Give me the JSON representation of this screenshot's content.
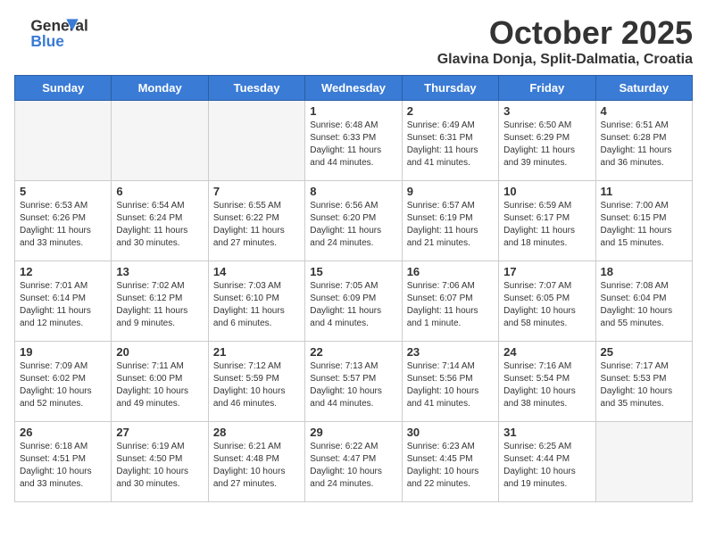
{
  "header": {
    "logo_general": "General",
    "logo_blue": "Blue",
    "month_title": "October 2025",
    "location": "Glavina Donja, Split-Dalmatia, Croatia"
  },
  "days_of_week": [
    "Sunday",
    "Monday",
    "Tuesday",
    "Wednesday",
    "Thursday",
    "Friday",
    "Saturday"
  ],
  "weeks": [
    [
      {
        "day": "",
        "empty": true
      },
      {
        "day": "",
        "empty": true
      },
      {
        "day": "",
        "empty": true
      },
      {
        "day": "1",
        "sunrise": "6:48 AM",
        "sunset": "6:33 PM",
        "daylight": "11 hours and 44 minutes."
      },
      {
        "day": "2",
        "sunrise": "6:49 AM",
        "sunset": "6:31 PM",
        "daylight": "11 hours and 41 minutes."
      },
      {
        "day": "3",
        "sunrise": "6:50 AM",
        "sunset": "6:29 PM",
        "daylight": "11 hours and 39 minutes."
      },
      {
        "day": "4",
        "sunrise": "6:51 AM",
        "sunset": "6:28 PM",
        "daylight": "11 hours and 36 minutes."
      }
    ],
    [
      {
        "day": "5",
        "sunrise": "6:53 AM",
        "sunset": "6:26 PM",
        "daylight": "11 hours and 33 minutes."
      },
      {
        "day": "6",
        "sunrise": "6:54 AM",
        "sunset": "6:24 PM",
        "daylight": "11 hours and 30 minutes."
      },
      {
        "day": "7",
        "sunrise": "6:55 AM",
        "sunset": "6:22 PM",
        "daylight": "11 hours and 27 minutes."
      },
      {
        "day": "8",
        "sunrise": "6:56 AM",
        "sunset": "6:20 PM",
        "daylight": "11 hours and 24 minutes."
      },
      {
        "day": "9",
        "sunrise": "6:57 AM",
        "sunset": "6:19 PM",
        "daylight": "11 hours and 21 minutes."
      },
      {
        "day": "10",
        "sunrise": "6:59 AM",
        "sunset": "6:17 PM",
        "daylight": "11 hours and 18 minutes."
      },
      {
        "day": "11",
        "sunrise": "7:00 AM",
        "sunset": "6:15 PM",
        "daylight": "11 hours and 15 minutes."
      }
    ],
    [
      {
        "day": "12",
        "sunrise": "7:01 AM",
        "sunset": "6:14 PM",
        "daylight": "11 hours and 12 minutes."
      },
      {
        "day": "13",
        "sunrise": "7:02 AM",
        "sunset": "6:12 PM",
        "daylight": "11 hours and 9 minutes."
      },
      {
        "day": "14",
        "sunrise": "7:03 AM",
        "sunset": "6:10 PM",
        "daylight": "11 hours and 6 minutes."
      },
      {
        "day": "15",
        "sunrise": "7:05 AM",
        "sunset": "6:09 PM",
        "daylight": "11 hours and 4 minutes."
      },
      {
        "day": "16",
        "sunrise": "7:06 AM",
        "sunset": "6:07 PM",
        "daylight": "11 hours and 1 minute."
      },
      {
        "day": "17",
        "sunrise": "7:07 AM",
        "sunset": "6:05 PM",
        "daylight": "10 hours and 58 minutes."
      },
      {
        "day": "18",
        "sunrise": "7:08 AM",
        "sunset": "6:04 PM",
        "daylight": "10 hours and 55 minutes."
      }
    ],
    [
      {
        "day": "19",
        "sunrise": "7:09 AM",
        "sunset": "6:02 PM",
        "daylight": "10 hours and 52 minutes."
      },
      {
        "day": "20",
        "sunrise": "7:11 AM",
        "sunset": "6:00 PM",
        "daylight": "10 hours and 49 minutes."
      },
      {
        "day": "21",
        "sunrise": "7:12 AM",
        "sunset": "5:59 PM",
        "daylight": "10 hours and 46 minutes."
      },
      {
        "day": "22",
        "sunrise": "7:13 AM",
        "sunset": "5:57 PM",
        "daylight": "10 hours and 44 minutes."
      },
      {
        "day": "23",
        "sunrise": "7:14 AM",
        "sunset": "5:56 PM",
        "daylight": "10 hours and 41 minutes."
      },
      {
        "day": "24",
        "sunrise": "7:16 AM",
        "sunset": "5:54 PM",
        "daylight": "10 hours and 38 minutes."
      },
      {
        "day": "25",
        "sunrise": "7:17 AM",
        "sunset": "5:53 PM",
        "daylight": "10 hours and 35 minutes."
      }
    ],
    [
      {
        "day": "26",
        "sunrise": "6:18 AM",
        "sunset": "4:51 PM",
        "daylight": "10 hours and 33 minutes."
      },
      {
        "day": "27",
        "sunrise": "6:19 AM",
        "sunset": "4:50 PM",
        "daylight": "10 hours and 30 minutes."
      },
      {
        "day": "28",
        "sunrise": "6:21 AM",
        "sunset": "4:48 PM",
        "daylight": "10 hours and 27 minutes."
      },
      {
        "day": "29",
        "sunrise": "6:22 AM",
        "sunset": "4:47 PM",
        "daylight": "10 hours and 24 minutes."
      },
      {
        "day": "30",
        "sunrise": "6:23 AM",
        "sunset": "4:45 PM",
        "daylight": "10 hours and 22 minutes."
      },
      {
        "day": "31",
        "sunrise": "6:25 AM",
        "sunset": "4:44 PM",
        "daylight": "10 hours and 19 minutes."
      },
      {
        "day": "",
        "empty": true
      }
    ]
  ]
}
